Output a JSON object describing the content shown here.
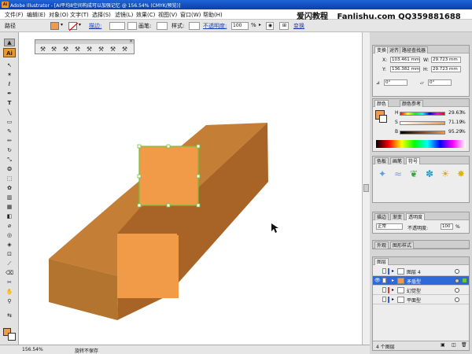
{
  "window": {
    "title": "Adobe Illustrator - [AI平均8空间构成可以加强记忆 @ 156.54% (CMYK/预览)]",
    "app_badge": "Ai"
  },
  "menubar": {
    "items": [
      "文件(F)",
      "编辑(E)",
      "对象(O)",
      "文字(T)",
      "选择(S)",
      "滤镜(L)",
      "效果(C)",
      "视图(V)",
      "窗口(W)",
      "帮助(H)"
    ],
    "brand": "爱闪教程",
    "site": "Fanlishu.com QQ359881688"
  },
  "controlbar": {
    "selection_label": "路径",
    "fill_color": "#f19a48",
    "stroke_label": "描边:",
    "brush_label": "画笔:",
    "style_label": "样式:",
    "opacity_label": "不透明度:",
    "opacity_value": "100",
    "opacity_unit": "%",
    "transform_link": "变换"
  },
  "colors": {
    "orange": "#f19a48",
    "top_face": "#c47e36",
    "right_face": "#a86426",
    "selection": "#6ec43a"
  },
  "float_toolbar": {
    "close": "×",
    "icons": [
      "graph-icon",
      "graph-icon",
      "graph-icon",
      "graph-icon",
      "graph-icon",
      "graph-icon",
      "graph-icon",
      "graph-icon"
    ]
  },
  "statusbar": {
    "zoom": "156.54%",
    "message": "旋转不保存"
  },
  "panels": {
    "transform": {
      "tabs": [
        "变换",
        "对齐",
        "路径查找器"
      ],
      "x_label": "X:",
      "x_value": "103.461 mm",
      "y_label": "Y:",
      "y_value": "136.382 mm",
      "w_label": "W:",
      "w_value": "29.723 mm",
      "h_label": "H:",
      "h_value": "29.723 mm",
      "angle_value": "0°",
      "shear_value": "0°"
    },
    "color": {
      "tabs": [
        "颜色",
        "颜色参考"
      ],
      "h_label": "H",
      "h_value": "29.63",
      "s_label": "S",
      "s_value": "71.19",
      "b_label": "B",
      "b_value": "95.29",
      "unit": "%"
    },
    "symbols": {
      "tabs": [
        "色板",
        "画笔",
        "符号"
      ]
    },
    "transparency": {
      "tabs": [
        "描边",
        "渐变",
        "透明度"
      ],
      "mode": "正常",
      "opacity_label": "不透明度:",
      "opacity_value": "100",
      "unit": "%"
    },
    "appearance": {
      "tabs": [
        "外观",
        "图形样式"
      ]
    },
    "layers": {
      "tabs": [
        "图层"
      ],
      "rows": [
        {
          "name": "图层 4",
          "color": "#3a5ad8",
          "selected": false
        },
        {
          "name": "矛盾型",
          "color": "#3a5ad8",
          "selected": true
        },
        {
          "name": "幻觉型",
          "color": "#d83a3a",
          "selected": false
        },
        {
          "name": "平面型",
          "color": "#3a5ad8",
          "selected": false
        }
      ],
      "count": "4 个图层"
    }
  }
}
